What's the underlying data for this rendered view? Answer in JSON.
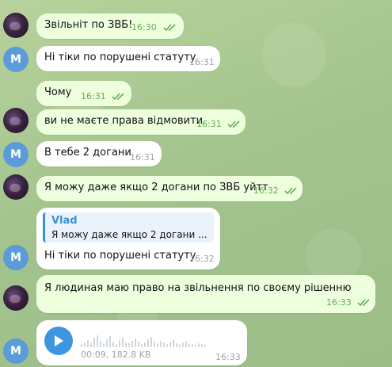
{
  "colors": {
    "accent": "#3f96e0",
    "outgoing_bubble": "#eeffde",
    "incoming_bubble": "#ffffff",
    "avatar_m": "#5b9bd8",
    "check": "#62ad54"
  },
  "messages": [
    {
      "text": "Звільніт по ЗВБ!",
      "time": "16:30",
      "outgoing": true
    },
    {
      "text": "Ні тіки по порушені статуту",
      "time": "16:31",
      "outgoing": false,
      "avatar": "M"
    },
    {
      "text": "Чому",
      "time": "16:31",
      "outgoing": true
    },
    {
      "text": "ви не маєте права відмовити",
      "time": "16:31",
      "outgoing": true
    },
    {
      "text": "В тебе 2 догани",
      "time": "16:31",
      "outgoing": false,
      "avatar": "M"
    },
    {
      "text": "Я можу  даже якщо 2 догани по ЗВБ уйтт",
      "time": "16:32",
      "outgoing": true
    },
    {
      "reply_author": "Vlad",
      "reply_text": "Я можу  даже якщо 2 догани ...",
      "text": "Ні тіки по порушені статуту",
      "time": "16:32",
      "outgoing": false,
      "avatar": "M"
    },
    {
      "text": "Я людиная маю право на звільнення по своєму рішенню",
      "time": "16:33",
      "outgoing": true
    },
    {
      "voice_meta": "00:09, 182.8 KB",
      "time": "16:33",
      "outgoing": false,
      "avatar": "M"
    }
  ],
  "icons": {
    "read_receipt": "double-check-icon",
    "play": "play-icon"
  }
}
